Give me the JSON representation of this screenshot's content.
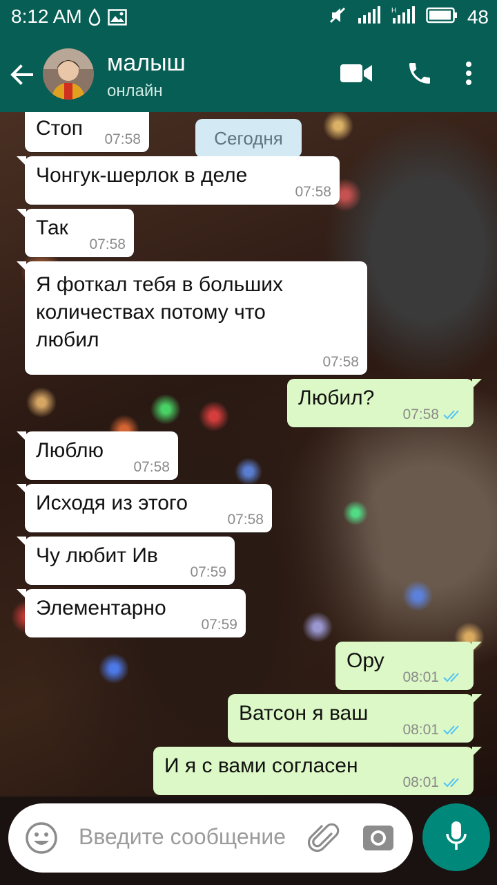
{
  "status_bar": {
    "time": "8:12 AM",
    "battery": "48",
    "icons": [
      "drop-icon",
      "image-icon",
      "mute-icon",
      "signal-icon",
      "signal-h-icon",
      "battery-icon"
    ]
  },
  "header": {
    "contact_name": "малыш",
    "contact_status": "онлайн",
    "icons": [
      "back-arrow-icon",
      "video-call-icon",
      "phone-call-icon",
      "more-options-icon"
    ]
  },
  "chat": {
    "date_label": "Сегодня",
    "messages": [
      {
        "direction": "in",
        "text": "Стоп",
        "time": "07:58"
      },
      {
        "direction": "in",
        "text": "Чонгук-шерлок в деле",
        "time": "07:58"
      },
      {
        "direction": "in",
        "text": "Так",
        "time": "07:58"
      },
      {
        "direction": "in",
        "lines": [
          "Я фоткал тебя в больших",
          "количествах потому что",
          "любил"
        ],
        "time": "07:58"
      },
      {
        "direction": "out",
        "text": "Любил?",
        "time": "07:58",
        "status": "read"
      },
      {
        "direction": "in",
        "text": "Люблю",
        "time": "07:58"
      },
      {
        "direction": "in",
        "text": "Исходя из этого",
        "time": "07:58"
      },
      {
        "direction": "in",
        "text": "Чу любит Ив",
        "time": "07:59"
      },
      {
        "direction": "in",
        "text": "Элементарно",
        "time": "07:59"
      },
      {
        "direction": "out",
        "text": "Ору",
        "time": "08:01",
        "status": "read"
      },
      {
        "direction": "out",
        "text": "Ватсон я ваш",
        "time": "08:01",
        "status": "read"
      },
      {
        "direction": "out",
        "text": "И я с вами согласен",
        "time": "08:01",
        "status": "read"
      }
    ]
  },
  "composer": {
    "placeholder": "Введите сообщение",
    "icons": [
      "emoji-icon",
      "attach-icon",
      "camera-icon",
      "mic-icon"
    ]
  },
  "colors": {
    "header_bg": "#075e54",
    "incoming_bubble": "#ffffff",
    "outgoing_bubble": "#dcf8c6",
    "read_tick": "#4fc3f7",
    "mic_button": "#00897b"
  }
}
